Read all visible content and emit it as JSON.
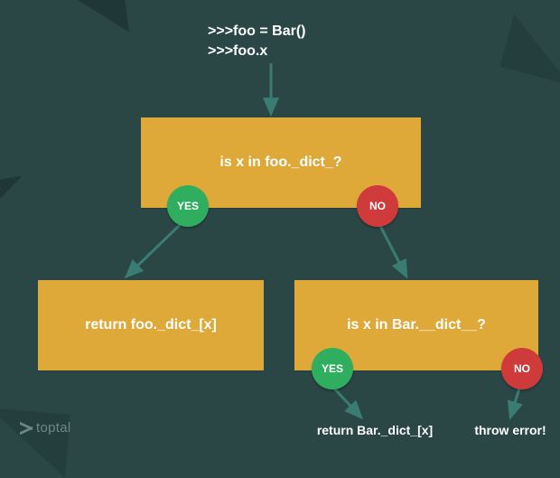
{
  "code": {
    "line1": ">>>foo = Bar()",
    "line2": ">>>foo.x"
  },
  "boxes": {
    "q1": "is x in foo._dict_?",
    "out_left": "return foo._dict_[x]",
    "q2": "is x in Bar.__dict__?"
  },
  "badges": {
    "yes": "YES",
    "no": "NO"
  },
  "leaves": {
    "return_bar": "return Bar._dict_[x]",
    "throw": "throw error!"
  },
  "logo": "toptal",
  "colors": {
    "bg": "#2a4645",
    "box": "#dfa93a",
    "yes": "#2fae60",
    "no": "#cf3a3a",
    "arrow": "#3a7c74"
  }
}
